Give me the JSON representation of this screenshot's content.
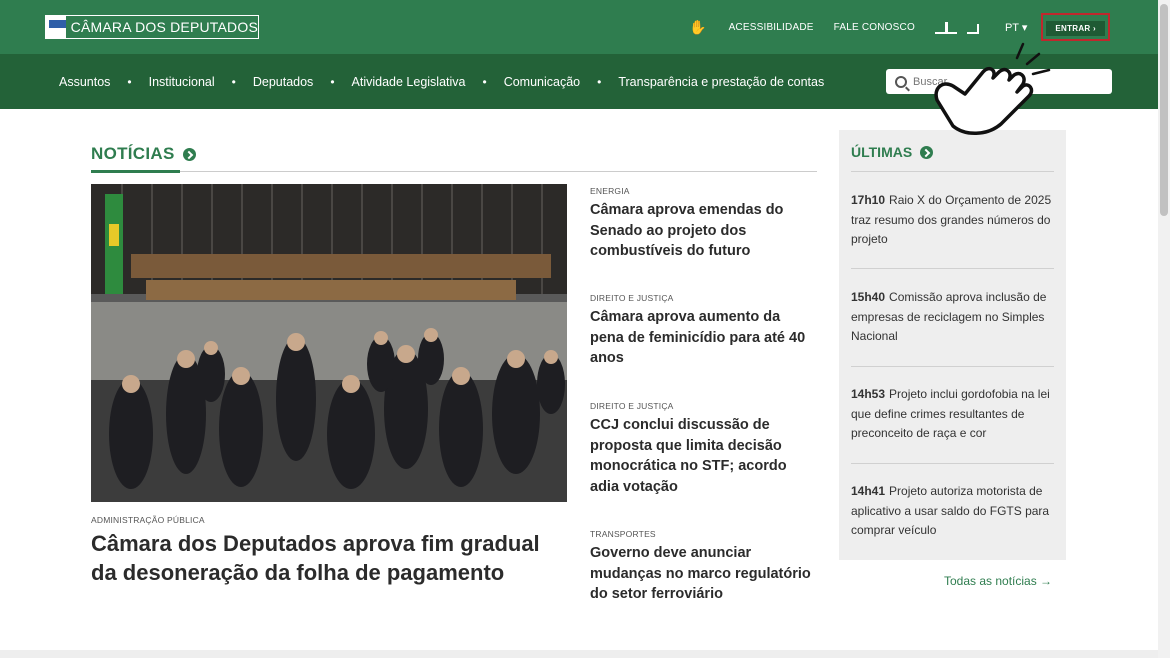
{
  "header": {
    "logo_text": "CÂMARA DOS DEPUTADOS",
    "links": [
      "ACESSIBILIDADE",
      "FALE CONOSCO"
    ],
    "lang": "PT ▾",
    "login_label": "ENTRAR ›"
  },
  "nav": {
    "items": [
      "Assuntos",
      "Institucional",
      "Deputados",
      "Atividade Legislativa",
      "Comunicação",
      "Transparência e prestação de contas"
    ],
    "search_placeholder": "Buscar"
  },
  "news": {
    "section_title": "NOTÍCIAS",
    "main": {
      "tag": "ADMINISTRAÇÃO PÚBLICA",
      "headline": "Câmara dos Deputados aprova fim gradual da desoneração da folha de pagamento"
    },
    "side": [
      {
        "tag": "ENERGIA",
        "headline": "Câmara aprova emendas do Senado ao projeto dos combustíveis do futuro"
      },
      {
        "tag": "DIREITO E JUSTIÇA",
        "headline": "Câmara aprova aumento da pena de feminicídio para até 40 anos"
      },
      {
        "tag": "DIREITO E JUSTIÇA",
        "headline": "CCJ conclui discussão de proposta que limita decisão monocrática no STF; acordo adia votação"
      },
      {
        "tag": "TRANSPORTES",
        "headline": "Governo deve anunciar mudanças no marco regulatório do setor ferroviário"
      }
    ]
  },
  "latest": {
    "title": "ÚLTIMAS",
    "items": [
      {
        "time": "17h10",
        "text": "Raio X do Orçamento de 2025 traz resumo dos grandes números do projeto"
      },
      {
        "time": "15h40",
        "text": "Comissão aprova inclusão de empresas de reciclagem no Simples Nacional"
      },
      {
        "time": "14h53",
        "text": "Projeto inclui gordofobia na lei que define crimes resultantes de preconceito de raça e cor"
      },
      {
        "time": "14h41",
        "text": "Projeto autoriza motorista de aplicativo a usar saldo do FGTS para comprar veículo"
      }
    ],
    "all_link": "Todas as notícias →"
  },
  "colors": {
    "topbar": "#2f7d4f",
    "nav": "#236238",
    "accent": "#2f7d4f",
    "highlight_border": "#c0272d"
  }
}
